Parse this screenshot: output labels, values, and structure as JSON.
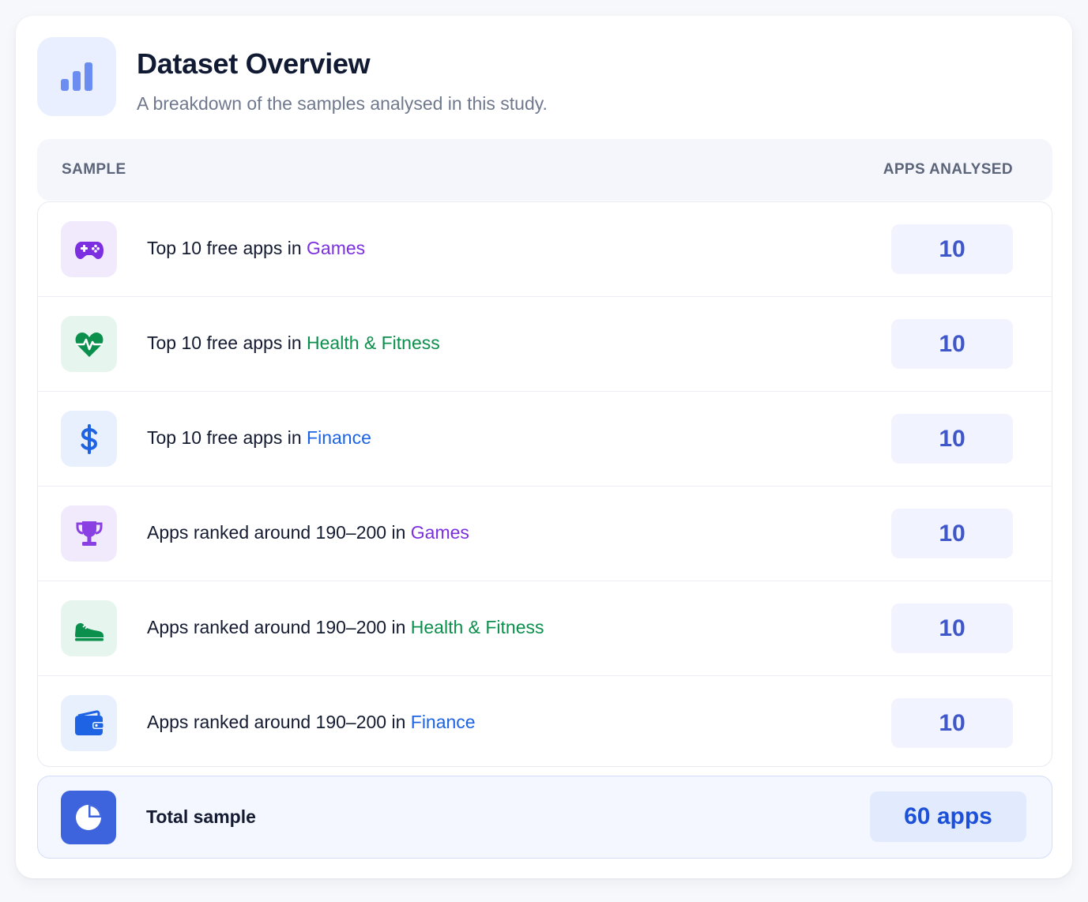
{
  "header": {
    "title": "Dataset Overview",
    "subtitle": "A breakdown of the samples analysed in this study.",
    "icon": "bar-chart-icon",
    "accent_color": "#5b82f0"
  },
  "table": {
    "columns": [
      "SAMPLE",
      "APPS ANALYSED"
    ],
    "rows": [
      {
        "prefix": "Top 10 free apps in ",
        "category": "Games",
        "category_color": "#7b2fe0",
        "icon": "gamepad-icon",
        "icon_bg": "#f1eafd",
        "count": "10"
      },
      {
        "prefix": "Top 10 free apps in ",
        "category": "Health & Fitness",
        "category_color": "#0b8f4d",
        "icon": "heartbeat-icon",
        "icon_bg": "#e6f5ee",
        "count": "10"
      },
      {
        "prefix": "Top 10 free apps in ",
        "category": "Finance",
        "category_color": "#1d63e3",
        "icon": "dollar-icon",
        "icon_bg": "#e8f0fd",
        "count": "10"
      },
      {
        "prefix": "Apps ranked around 190–200 in ",
        "category": "Games",
        "category_color": "#7b2fe0",
        "icon": "trophy-icon",
        "icon_bg": "#f1eafd",
        "count": "10"
      },
      {
        "prefix": "Apps ranked around 190–200 in ",
        "category": "Health & Fitness",
        "category_color": "#0b8f4d",
        "icon": "sneaker-icon",
        "icon_bg": "#e6f5ee",
        "count": "10"
      },
      {
        "prefix": "Apps ranked around 190–200 in ",
        "category": "Finance",
        "category_color": "#1d63e3",
        "icon": "wallet-icon",
        "icon_bg": "#e8f0fd",
        "count": "10"
      }
    ]
  },
  "total": {
    "label": "Total sample",
    "value": "60 apps",
    "icon": "pie-chart-icon"
  }
}
